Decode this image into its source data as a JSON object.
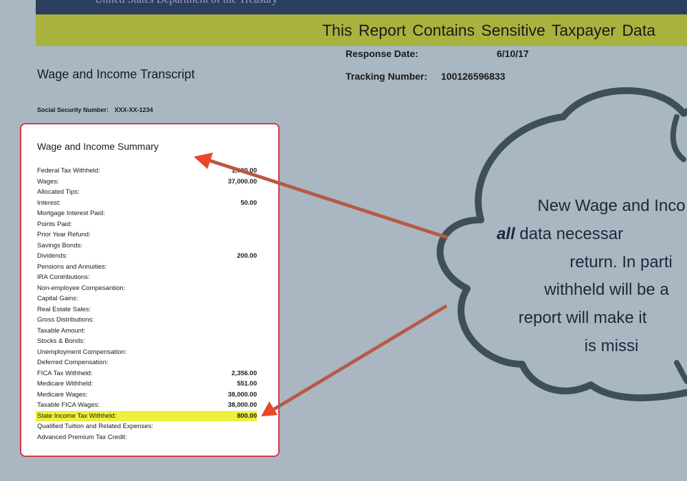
{
  "header": {
    "agency": "United States Department of the Treasury",
    "banner": "This Report Contains Sensitive Taxpayer Data"
  },
  "document": {
    "title": "Wage and Income Transcript",
    "response_date_label": "Response Date:",
    "response_date_value": "6/10/17",
    "tracking_label": "Tracking Number:",
    "tracking_value": "100126596833",
    "ssn_label": "Social Security Number:",
    "ssn_value": "XXX-XX-1234"
  },
  "summary": {
    "title": "Wage and Income Summary",
    "rows": [
      {
        "label": "Federal Tax Withheld:",
        "value": "1,000.00"
      },
      {
        "label": "Wages:",
        "value": "37,000.00"
      },
      {
        "label": "Allocated Tips:",
        "value": ""
      },
      {
        "label": "Interest:",
        "value": "50.00"
      },
      {
        "label": "Mortgage Interest Paid:",
        "value": ""
      },
      {
        "label": "Points Paid:",
        "value": ""
      },
      {
        "label": "Prior Year Refund:",
        "value": ""
      },
      {
        "label": "Savings Bonds:",
        "value": ""
      },
      {
        "label": "Dividends:",
        "value": "200.00"
      },
      {
        "label": "Pensions and Annuities:",
        "value": ""
      },
      {
        "label": "IRA Contributions:",
        "value": ""
      },
      {
        "label": "Non-employee Compesantion:",
        "value": ""
      },
      {
        "label": "Capital Gains:",
        "value": ""
      },
      {
        "label": "Real Estate Sales:",
        "value": ""
      },
      {
        "label": "Gross Distributions:",
        "value": ""
      },
      {
        "label": "Taxable Amount:",
        "value": ""
      },
      {
        "label": "Stocks & Bonds:",
        "value": ""
      },
      {
        "label": "Unemployment Compensation:",
        "value": ""
      },
      {
        "label": "Deferred Compensation:",
        "value": ""
      },
      {
        "label": "FICA Tax Withheld:",
        "value": "2,356.00"
      },
      {
        "label": "Medicare Withheld:",
        "value": "551.00"
      },
      {
        "label": "Medicare Wages:",
        "value": "38,000.00"
      },
      {
        "label": "Taxable FICA Wages:",
        "value": "38,000.00"
      },
      {
        "label": "State Income Tax Withheld:",
        "value": "800.00"
      },
      {
        "label": "Qualified Tuition and Related Expenses:",
        "value": ""
      },
      {
        "label": "Advanced Premium Tax Credit:",
        "value": ""
      }
    ]
  },
  "callout": {
    "line1": "New Wage and Inco",
    "line2_em": "all",
    "line2_rest": " data necessar",
    "line3": "return.  In parti",
    "line4": "withheld will be a",
    "line5": "report will make it",
    "line6": "is missi"
  },
  "colors": {
    "background": "#a9b7c3",
    "banner": "#a9b23e",
    "topbar": "#2b3e5f",
    "summary_border": "#d8344a",
    "highlight": "#eef03a",
    "arrow": "#b85a45",
    "arrow_head": "#e8472a",
    "cloud_outline": "#3f4f5a"
  }
}
